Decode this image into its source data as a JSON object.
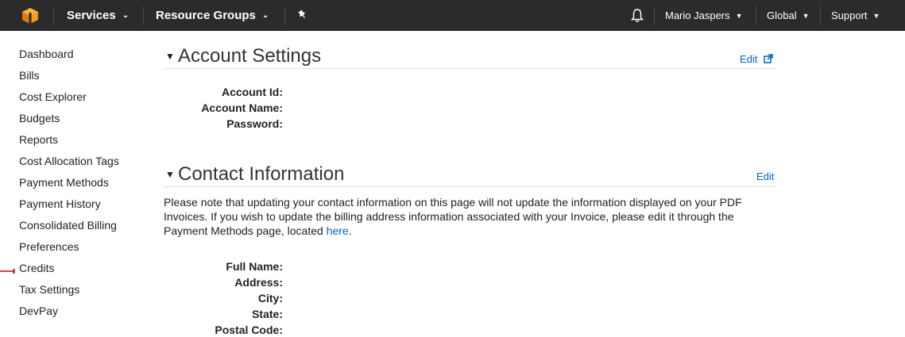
{
  "topbar": {
    "services_label": "Services",
    "resource_groups_label": "Resource Groups",
    "user_label": "Mario Jaspers",
    "region_label": "Global",
    "support_label": "Support",
    "logo_color": "#f90",
    "background_color": "#2b2b2b"
  },
  "sidebar": {
    "items": [
      {
        "label": "Dashboard"
      },
      {
        "label": "Bills"
      },
      {
        "label": "Cost Explorer"
      },
      {
        "label": "Budgets"
      },
      {
        "label": "Reports"
      },
      {
        "label": "Cost Allocation Tags"
      },
      {
        "label": "Payment Methods"
      },
      {
        "label": "Payment History"
      },
      {
        "label": "Consolidated Billing"
      },
      {
        "label": "Preferences"
      },
      {
        "label": "Credits"
      },
      {
        "label": "Tax Settings"
      },
      {
        "label": "DevPay"
      }
    ],
    "marker_color": "#cc0000"
  },
  "account_settings": {
    "title": "Account Settings",
    "edit_label": "Edit",
    "fields": [
      {
        "label": "Account Id:"
      },
      {
        "label": "Account Name:"
      },
      {
        "label": "Password:"
      }
    ]
  },
  "contact_information": {
    "title": "Contact Information",
    "edit_label": "Edit",
    "note_text": "Please note that updating your contact information on this page will not update the information displayed on your PDF Invoices. If you wish to update the billing address information associated with your Invoice, please edit it through the Payment Methods page, located ",
    "note_link": "here",
    "note_end": ".",
    "fields": [
      {
        "label": "Full Name:"
      },
      {
        "label": "Address:"
      },
      {
        "label": "City:"
      },
      {
        "label": "State:"
      },
      {
        "label": "Postal Code:"
      }
    ]
  },
  "colors": {
    "link": "#0066c0"
  }
}
